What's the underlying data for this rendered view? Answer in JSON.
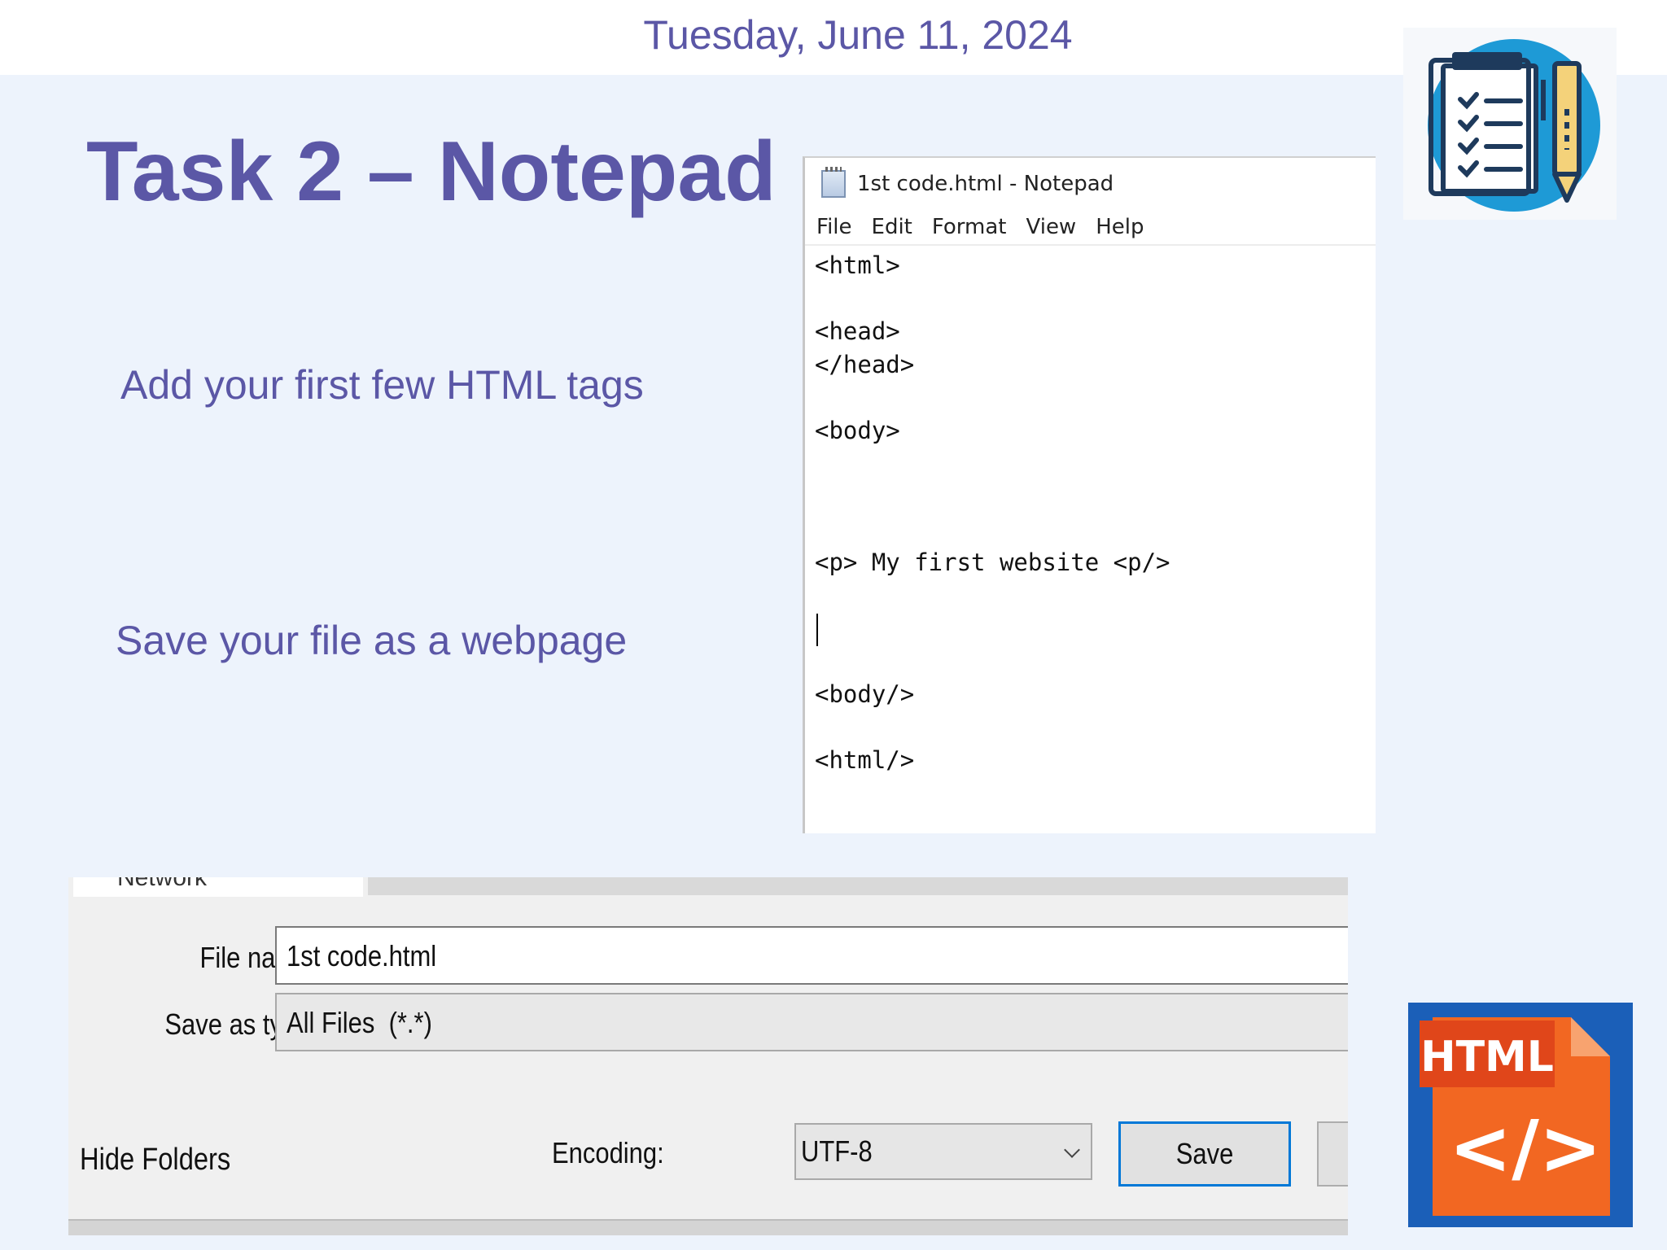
{
  "slide": {
    "date": "Tuesday, June 11, 2024",
    "title": "Task 2 – Notepad",
    "instructions": [
      "Add your first few HTML tags",
      "Save your file as a webpage"
    ]
  },
  "notepad": {
    "window_title": "1st code.html - Notepad",
    "menu": [
      "File",
      "Edit",
      "Format",
      "View",
      "Help"
    ],
    "code_lines": [
      "<html>",
      "",
      "<head>",
      "</head>",
      "",
      "<body>",
      "",
      "",
      "",
      "<p> My first website <p/>",
      "",
      "",
      "",
      "<body/>",
      "",
      "<html/>"
    ]
  },
  "save_dialog": {
    "location_partial": "Network",
    "file_name_label": "File name:",
    "file_name_value": "1st code.html",
    "save_as_type_label": "Save as type:",
    "save_as_type_value": "All Files  (*.*)",
    "hide_folders": "Hide Folders",
    "encoding_label": "Encoding:",
    "encoding_value": "UTF-8",
    "save_button": "Save"
  },
  "html_icon": {
    "label": "HTML",
    "glyph": "</>"
  },
  "colors": {
    "slide_text": "#5b57a6",
    "slide_bg": "#edf3fc",
    "html_icon_bg": "#1b5fb8",
    "html_icon_orange": "#f26722",
    "save_focus": "#0078d7"
  },
  "icons": [
    "checklist-clipboard-icon",
    "pencil-icon",
    "notepad-app-icon",
    "html-file-icon",
    "chevron-down-icon",
    "back-arrow-icon"
  ]
}
